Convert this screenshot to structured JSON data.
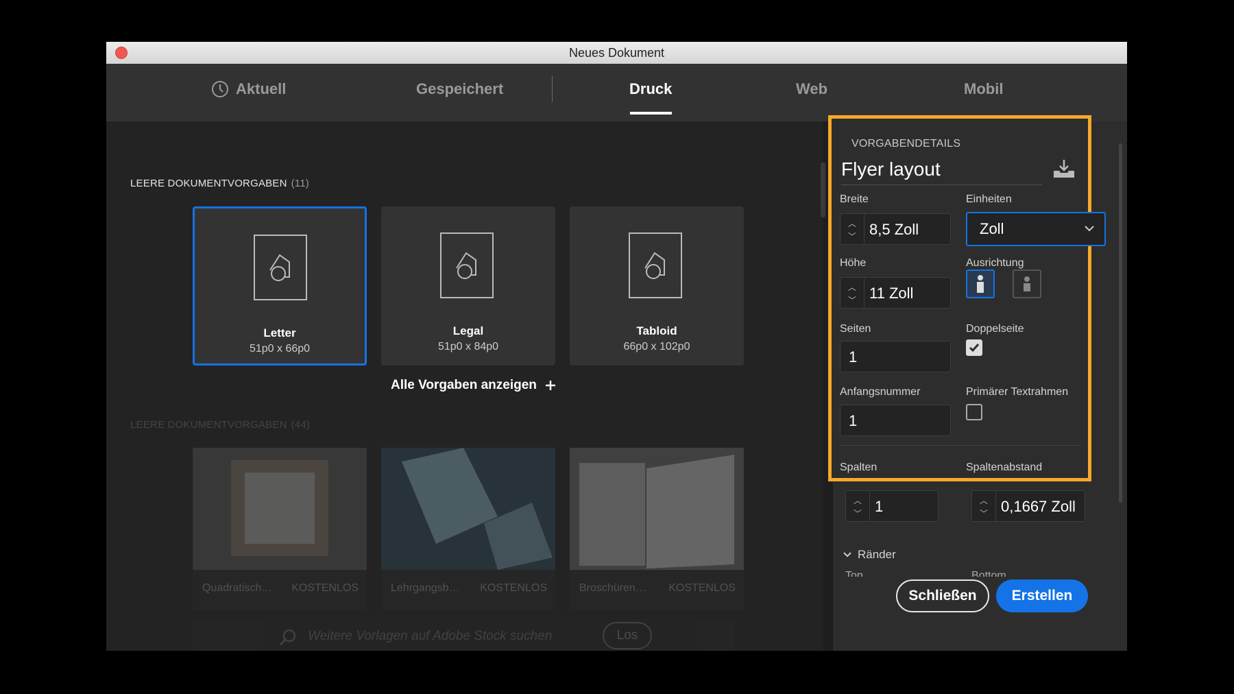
{
  "window": {
    "title": "Neues Dokument"
  },
  "tabs": [
    {
      "label": "Aktuell"
    },
    {
      "label": "Gespeichert"
    },
    {
      "label": "Druck"
    },
    {
      "label": "Web"
    },
    {
      "label": "Mobil"
    }
  ],
  "active_tab": "Druck",
  "blank_presets": {
    "label": "LEERE DOKUMENTVORGABEN",
    "count": "(11)",
    "items": [
      {
        "name": "Letter",
        "size": "51p0 x 66p0",
        "selected": true
      },
      {
        "name": "Legal",
        "size": "51p0 x 84p0",
        "selected": false
      },
      {
        "name": "Tabloid",
        "size": "66p0 x 102p0",
        "selected": false
      }
    ],
    "show_all": "Alle Vorgaben anzeigen"
  },
  "stock_presets": {
    "label": "LEERE DOKUMENTVORGABEN",
    "count": "(44)",
    "items": [
      {
        "name": "Quadratisch…",
        "badge": "KOSTENLOS"
      },
      {
        "name": "Lehrgangsb…",
        "badge": "KOSTENLOS"
      },
      {
        "name": "Broschüren…",
        "badge": "KOSTENLOS"
      }
    ],
    "search_placeholder": "Weitere Vorlagen auf Adobe Stock suchen",
    "search_button": "Los"
  },
  "details": {
    "heading": "VORGABENDETAILS",
    "preset_name": "Flyer layout",
    "width_label": "Breite",
    "width_value": "8,5 Zoll",
    "units_label": "Einheiten",
    "units_value": "Zoll",
    "height_label": "Höhe",
    "height_value": "11 Zoll",
    "orientation_label": "Ausrichtung",
    "orientation_selected": "portrait",
    "pages_label": "Seiten",
    "pages_value": "1",
    "facing_label": "Doppelseite",
    "facing_checked": true,
    "start_label": "Anfangsnummer",
    "start_value": "1",
    "primary_frame_label": "Primärer Textrahmen",
    "primary_frame_checked": false,
    "columns_label": "Spalten",
    "columns_value": "1",
    "gutter_label": "Spaltenabstand",
    "gutter_value": "0,1667 Zoll"
  },
  "margins": {
    "label": "Ränder",
    "top_label": "Top",
    "bottom_label": "Bottom"
  },
  "buttons": {
    "close": "Schließen",
    "create": "Erstellen"
  },
  "colors": {
    "accent": "#1473e6",
    "highlight": "#f7a82a",
    "close_dot": "#ee5a52"
  }
}
